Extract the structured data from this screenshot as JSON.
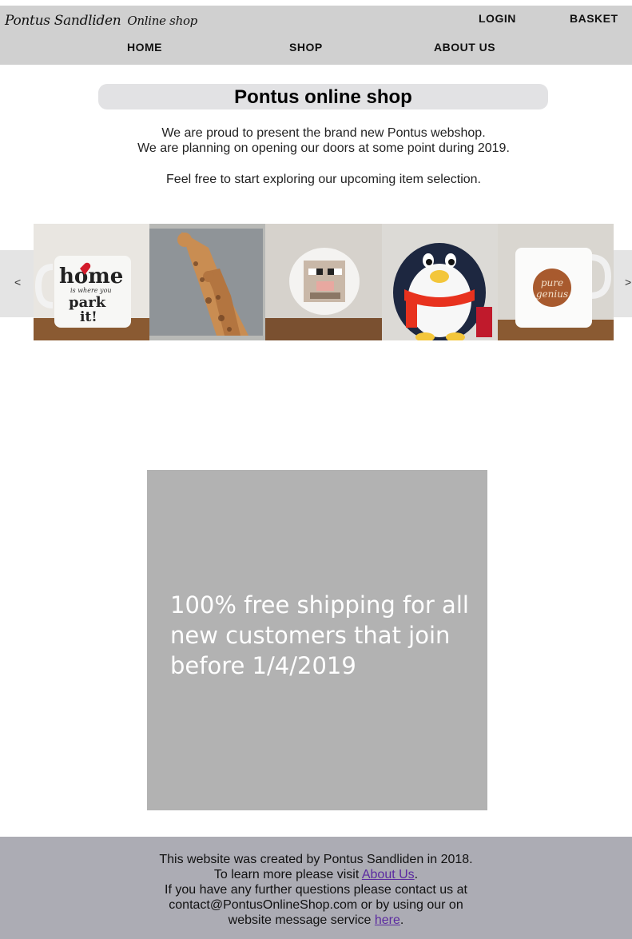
{
  "header": {
    "logo_name": "Pontus Sandliden",
    "logo_shop": "Online shop",
    "login": "LOGIN",
    "basket": "BASKET",
    "nav": [
      "HOME",
      "SHOP",
      "ABOUT US"
    ]
  },
  "hero": {
    "title": "Pontus online shop",
    "intro_line1": "We are proud to present the brand new Pontus webshop.",
    "intro_line2": "We are planning on opening our doors at some point during 2019.",
    "intro_line3": "Feel free to start exploring our upcoming item selection."
  },
  "carousel": {
    "prev": "<",
    "next": ">",
    "items": [
      {
        "name": "home-mug",
        "text1": "home",
        "text2": "is where you",
        "text3": "park",
        "text4": "it!"
      },
      {
        "name": "giraffe-pillow"
      },
      {
        "name": "sheep-plush"
      },
      {
        "name": "penguin-plush"
      },
      {
        "name": "pure-genius-mug",
        "text1": "pure",
        "text2": "genius"
      }
    ]
  },
  "promo": {
    "text": "100% free shipping for all new customers that join before 1/4/2019"
  },
  "footer": {
    "line1": "This website was created by Pontus Sandliden in 2018.",
    "line2_prefix": "To learn more please visit ",
    "line2_link": "About Us",
    "line2_suffix": ".",
    "line3": "If you have any further questions please contact us at",
    "line4": "contact@PontusOnlineShop.com or by using our on",
    "line5_prefix": "website message service ",
    "line5_link": "here",
    "line5_suffix": "."
  },
  "colors": {
    "header_bg": "#d0d0d0",
    "promo_bg": "#b2b2b2",
    "footer_bg": "#acacb4",
    "link": "#5b2aa0"
  }
}
